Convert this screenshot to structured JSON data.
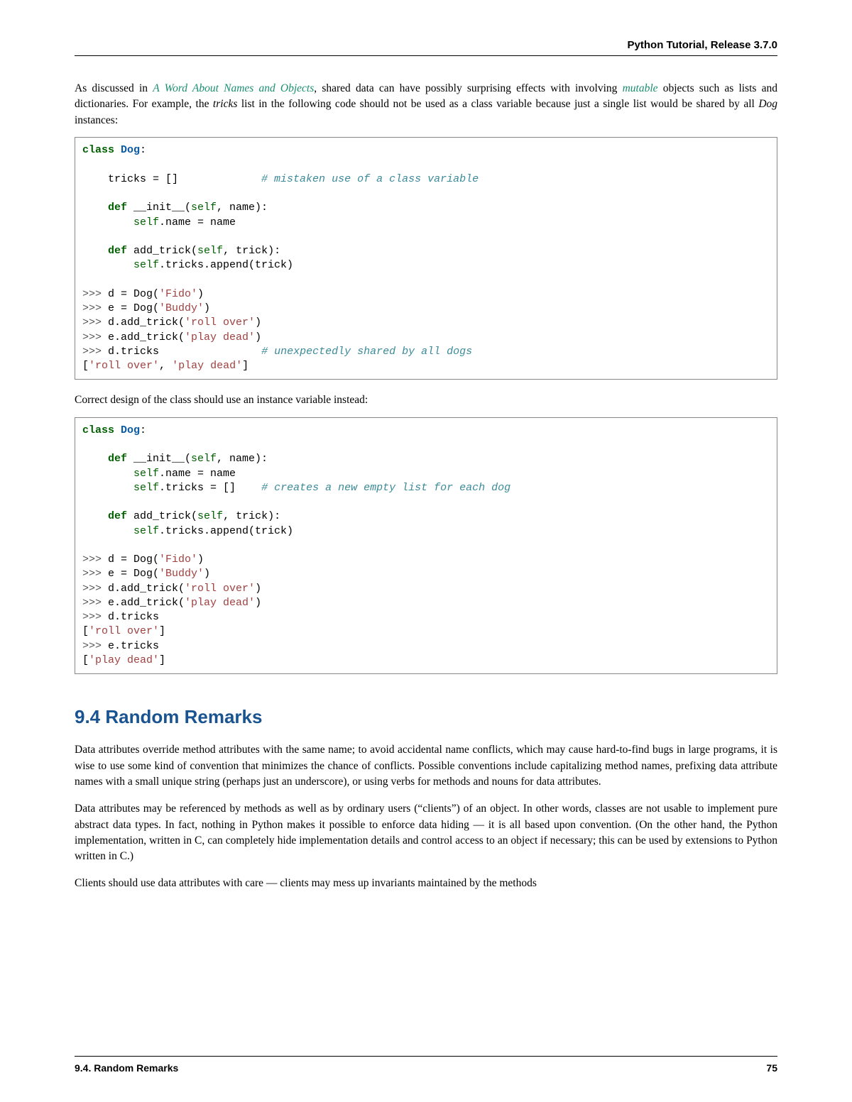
{
  "header": {
    "title": "Python Tutorial, Release 3.7.0"
  },
  "para1": {
    "pre": "As discussed in ",
    "link": "A Word About Names and Objects",
    "post1": ", shared data can have possibly surprising effects with involving ",
    "mutable": "mutable",
    "post2": " objects such as lists and dictionaries.  For example, the ",
    "tricks": "tricks",
    "post3": " list in the following code should not be used as a class variable because just a single list would be shared by all ",
    "dog": "Dog",
    "post4": " instances:"
  },
  "code1": {
    "l1a": "class",
    "l1b": " Dog",
    "l1c": ":",
    "l2": "",
    "l3a": "    tricks = []             ",
    "l3b": "# mistaken use of a class variable",
    "l4": "",
    "l5a": "    def",
    "l5b": " __init__(",
    "l5c": "self",
    "l5d": ", name):",
    "l6a": "        ",
    "l6b": "self",
    "l6c": ".name = name",
    "l7": "",
    "l8a": "    def",
    "l8b": " add_trick(",
    "l8c": "self",
    "l8d": ", trick):",
    "l9a": "        ",
    "l9b": "self",
    "l9c": ".tricks.append(trick)",
    "l10": "",
    "l11a": ">>> ",
    "l11b": "d = Dog(",
    "l11c": "'Fido'",
    "l11d": ")",
    "l12a": ">>> ",
    "l12b": "e = Dog(",
    "l12c": "'Buddy'",
    "l12d": ")",
    "l13a": ">>> ",
    "l13b": "d.add_trick(",
    "l13c": "'roll over'",
    "l13d": ")",
    "l14a": ">>> ",
    "l14b": "e.add_trick(",
    "l14c": "'play dead'",
    "l14d": ")",
    "l15a": ">>> ",
    "l15b": "d.tricks                ",
    "l15c": "# unexpectedly shared by all dogs",
    "l16a": "[",
    "l16b": "'roll over'",
    "l16c": ", ",
    "l16d": "'play dead'",
    "l16e": "]"
  },
  "para2": "Correct design of the class should use an instance variable instead:",
  "code2": {
    "l1a": "class",
    "l1b": " Dog",
    "l1c": ":",
    "l2": "",
    "l3a": "    def",
    "l3b": " __init__(",
    "l3c": "self",
    "l3d": ", name):",
    "l4a": "        ",
    "l4b": "self",
    "l4c": ".name = name",
    "l5a": "        ",
    "l5b": "self",
    "l5c": ".tricks = []    ",
    "l5d": "# creates a new empty list for each dog",
    "l6": "",
    "l7a": "    def",
    "l7b": " add_trick(",
    "l7c": "self",
    "l7d": ", trick):",
    "l8a": "        ",
    "l8b": "self",
    "l8c": ".tricks.append(trick)",
    "l9": "",
    "l10a": ">>> ",
    "l10b": "d = Dog(",
    "l10c": "'Fido'",
    "l10d": ")",
    "l11a": ">>> ",
    "l11b": "e = Dog(",
    "l11c": "'Buddy'",
    "l11d": ")",
    "l12a": ">>> ",
    "l12b": "d.add_trick(",
    "l12c": "'roll over'",
    "l12d": ")",
    "l13a": ">>> ",
    "l13b": "e.add_trick(",
    "l13c": "'play dead'",
    "l13d": ")",
    "l14a": ">>> ",
    "l14b": "d.tricks",
    "l15a": "[",
    "l15b": "'roll over'",
    "l15c": "]",
    "l16a": ">>> ",
    "l16b": "e.tricks",
    "l17a": "[",
    "l17b": "'play dead'",
    "l17c": "]"
  },
  "section": {
    "heading": "9.4 Random Remarks",
    "p1": "Data attributes override method attributes with the same name; to avoid accidental name conflicts, which may cause hard-to-find bugs in large programs, it is wise to use some kind of convention that minimizes the chance of conflicts. Possible conventions include capitalizing method names, prefixing data attribute names with a small unique string (perhaps just an underscore), or using verbs for methods and nouns for data attributes.",
    "p2": "Data attributes may be referenced by methods as well as by ordinary users (“clients”) of an object.  In other words, classes are not usable to implement pure abstract data types.  In fact, nothing in Python makes it possible to enforce data hiding — it is all based upon convention. (On the other hand, the Python implementation, written in C, can completely hide implementation details and control access to an object if necessary; this can be used by extensions to Python written in C.)",
    "p3": "Clients should use data attributes with care — clients may mess up invariants maintained by the methods"
  },
  "footer": {
    "left": "9.4.   Random Remarks",
    "right": "75"
  }
}
